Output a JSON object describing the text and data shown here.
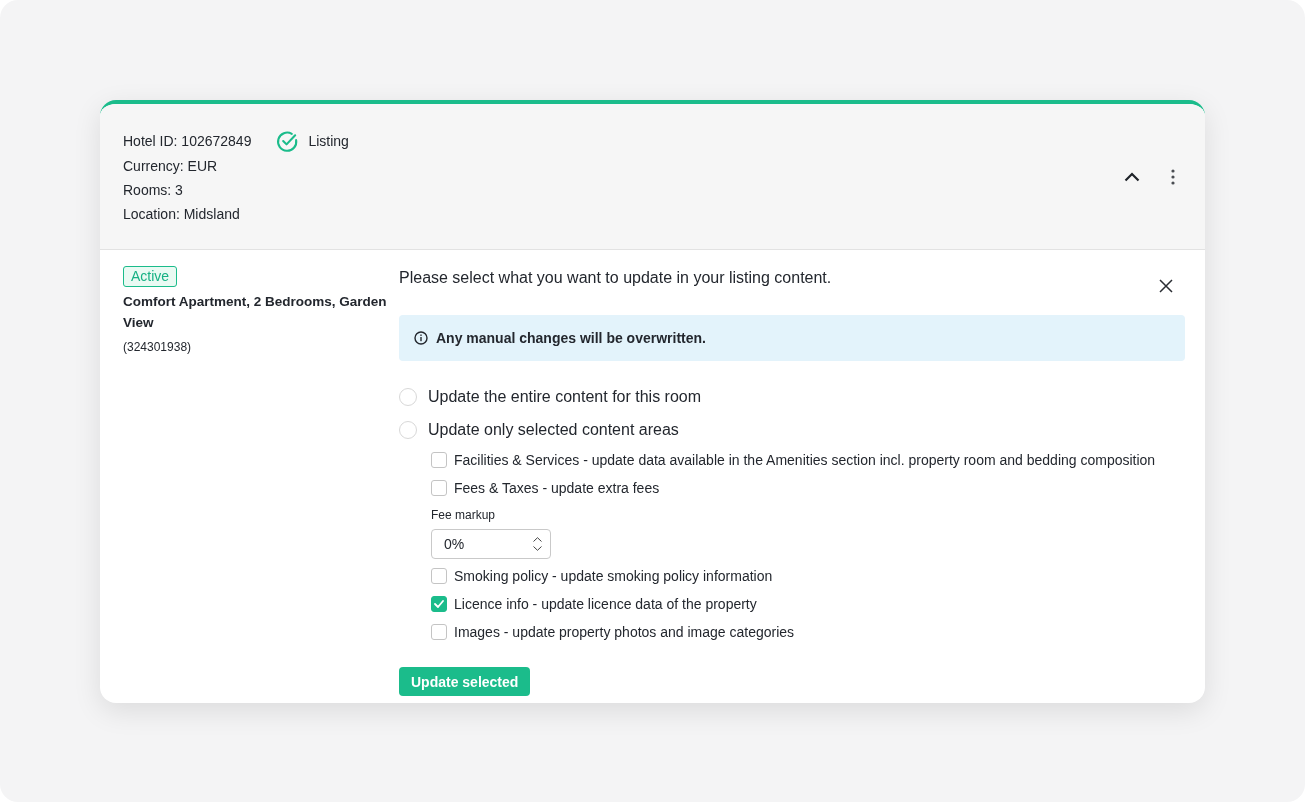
{
  "hotel": {
    "expanded": true,
    "details": [
      "Hotel ID: 102672849",
      "Currency: EUR",
      "Rooms: 3",
      "Location: Midsland"
    ],
    "status": "Listing"
  },
  "room": {
    "badge": "Active",
    "name": "Comfort Apartment, 2 Bedrooms, Garden View",
    "code": "(324301938)"
  },
  "update_panel": {
    "heading": "Please select what you want to update in your listing content.",
    "notice": "Any manual changes will be overwritten.",
    "options": [
      {
        "label": "Update the entire content for this room",
        "selected": false
      },
      {
        "label": "Update only selected content areas",
        "selected": false
      }
    ],
    "areas": [
      {
        "kind": "checkbox",
        "label": "Facilities & Services - update data available in the Amenities section incl. property room and bedding composition",
        "checked": false
      },
      {
        "kind": "checkbox",
        "label": "Fees & Taxes - update extra fees",
        "checked": false
      },
      {
        "kind": "number",
        "label": "Fee markup",
        "value": "0%"
      },
      {
        "kind": "checkbox",
        "label": "Smoking policy - update smoking policy information",
        "checked": false
      },
      {
        "kind": "checkbox",
        "label": "Licence info - update licence data of the property",
        "checked": true
      },
      {
        "kind": "checkbox",
        "label": "Images - update property photos and image categories",
        "checked": false
      }
    ],
    "submit": "Update selected"
  }
}
